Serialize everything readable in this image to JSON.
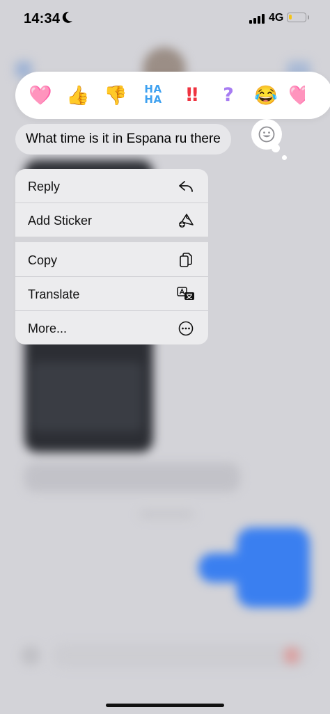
{
  "status_bar": {
    "time": "14:34",
    "network": "4G",
    "battery_percent": 20
  },
  "reactions": {
    "items": [
      {
        "name": "heart",
        "glyph": "🩷"
      },
      {
        "name": "thumbs-up",
        "glyph": "👍"
      },
      {
        "name": "thumbs-down",
        "glyph": "👎"
      },
      {
        "name": "haha",
        "line1": "HA",
        "line2": "HA"
      },
      {
        "name": "emphasize",
        "glyph": "‼"
      },
      {
        "name": "question",
        "glyph": "?"
      },
      {
        "name": "laughing",
        "glyph": "😂"
      },
      {
        "name": "heart-partial",
        "glyph": "🩷"
      }
    ]
  },
  "message": {
    "text": "What time is it in Espana ru there"
  },
  "context_menu": {
    "items": [
      {
        "label": "Reply",
        "icon": "reply-arrow-icon"
      },
      {
        "label": "Add Sticker",
        "icon": "sticker-add-icon"
      },
      {
        "label": "Copy",
        "icon": "copy-icon"
      },
      {
        "label": "Translate",
        "icon": "translate-icon"
      },
      {
        "label": "More...",
        "icon": "more-ellipsis-icon"
      }
    ]
  },
  "colors": {
    "accent_blue": "#3a7ff0",
    "menu_bg": "#ececee",
    "bubble_bg": "#e7e7ea"
  }
}
